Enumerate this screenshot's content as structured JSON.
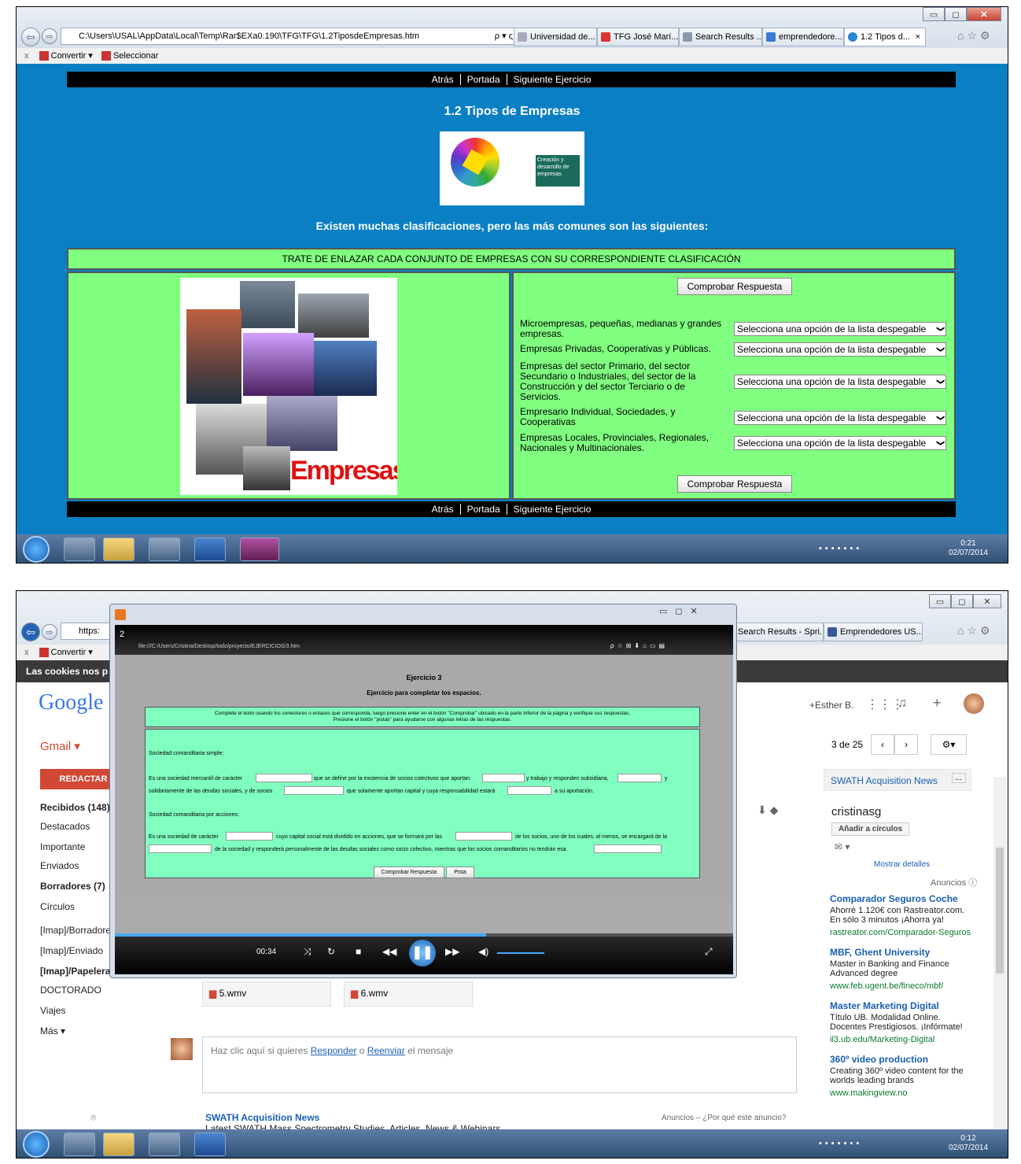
{
  "s1": {
    "address": "C:\\Users\\USAL\\AppData\\Local\\Temp\\Rar$EXa0.190\\TFG\\TFG\\1.2TiposdeEmpresas.htm",
    "search_glyphs": "ρ ▾ ς",
    "tabs": [
      "Universidad de...",
      "TFG José Marí...",
      "Search Results ...",
      "emprendedore...",
      "1.2 Tipos d..."
    ],
    "tab_close": "×",
    "cmd_close": "x",
    "cmd_convert": "Convertir",
    "cmd_select": "Seleccionar",
    "nav": {
      "back": "Atrás",
      "cover": "Portada",
      "next": "Siguiente Ejercicio"
    },
    "title": "1.2 Tipos de Empresas",
    "logo_text": "Creación y desarrollo de empresas",
    "subtitle": "Existen muchas clasificaciones, pero las más comunes son las siguientes:",
    "instruction": "TRATE DE ENLAZAR CADA CONJUNTO DE EMPRESAS CON SU CORRESPONDIENTE CLASIFICACIÓN",
    "image_caption": "Empresas",
    "check_button": "Comprobar Respuesta",
    "questions": [
      "Microempresas, pequeñas, medianas y grandes empresas.",
      "Empresas Privadas, Cooperativas y Públicas.",
      "Empresas del sector Primario, del sector Secundario o Industriales, del sector de la Construcción y del sector Terciario o de Servicios.",
      "Empresario Individual, Sociedades, y Cooperativas",
      "Empresas Locales, Provinciales, Regionales, Nacionales y Multinacionales."
    ],
    "select_placeholder": "Selecciona una opción de la lista despegable",
    "clock_time": "0:21",
    "clock_date": "02/07/2014"
  },
  "s2": {
    "gmail_address": "https:",
    "gmail_tabs": [
      "Search Results - Spri...",
      "Emprendedores US..."
    ],
    "cmd_convert": "Convertir",
    "cookies": "Las cookies nos p",
    "google": "Google",
    "gmail": "Gmail ▾",
    "user": "+Esther B.",
    "compose": "REDACTAR",
    "folders": [
      "Recibidos (148)",
      "Destacados",
      "Importante",
      "Enviados",
      "Borradores (7)",
      "Círculos",
      "[Imap]/Borradore",
      "[Imap]/Enviado",
      "[Imap]/Papelera",
      "DOCTORADO",
      "Viajes",
      "Más ▾"
    ],
    "pager": "3 de 25",
    "contact_card_title": "SWATH Acquisition News",
    "contact_card_more": "...",
    "contact_name": "cristinasg",
    "add_circles": "Añadir a círculos",
    "show_details": "Mostrar detalles",
    "ads_label": "Anuncios ⓘ",
    "ads": [
      {
        "title": "Comparador Seguros Coche",
        "body": "Ahorré 1.120€ con Rastreator.com. En sólo 3 minutos ¡Ahorra ya!",
        "url": "rastreator.com/Comparador-Seguros"
      },
      {
        "title": "MBF, Ghent University",
        "body": "Master in Banking and Finance Advanced degree",
        "url": "www.feb.ugent.be/fineco/mbf/"
      },
      {
        "title": "Master Marketing Digital",
        "body": "Título UB. Modalidad Online. Docentes Prestigiosos. ¡Infórmate!",
        "url": "il3.ub.edu/Marketing-Digital"
      },
      {
        "title": "360º video production",
        "body": "Creating 360º video content for the worlds leading brands",
        "url": "www.makingview.no"
      }
    ],
    "attachments": [
      "5.wmv",
      "6.wmv"
    ],
    "reply_text_pre": "Haz clic aquí si quieres ",
    "reply_link": "Responder",
    "reply_mid": " o ",
    "forward_link": "Reenviar",
    "reply_post": " el mensaje",
    "bottom_sender": "SWATH Acquisition News",
    "bottom_ads": "Anuncios – ¿Por qué este anuncio?",
    "bottom_snippet": "Latest SWATH Mass Spectrometry Studies, Articles, News & Webinars",
    "player_title": "2",
    "player_addr": "file:///C:/Users/Cristina/Desktop/todo/proyecto/EJERCICIOS/3.htm",
    "player_time": "00:34",
    "ex_title": "Ejercicio 3",
    "ex_subtitle": "Ejercicio para completar los espacios.",
    "ex_instruction1": "Complete el texto usando los conectores o enlaces que corresponda, luego presione enter en el botón \"Comprobar\" ubicado en la parte inferior de la página y verifique sus respuestas.",
    "ex_instruction2": "Presione el botón \"pistas\" para ayudarse con algunas letras de las respuestas.",
    "ex_h1": "Sociedad comanditaria simple:",
    "ex_l1a": "Es una sociedad mercantil de carácter",
    "ex_l1b": "que se define por la existencia de socios colectivos que aportan",
    "ex_l1c": "y trabajo y responden subsidiaria,",
    "ex_l1d": "y",
    "ex_l2a": "solidariamente de las deudas sociales, y de socios",
    "ex_l2b": "que solamente aportan capital y cuya responsabilidad estará",
    "ex_l2c": "a su aportación.",
    "ex_h2": "Sociedad comanditaria por acciones:",
    "ex_l3a": "Es una sociedad de carácter",
    "ex_l3b": "cuyo capital social está dividido en acciones, que se formará por las",
    "ex_l3c": "de los socios, uno de los cuales, al menos, se encargará de la",
    "ex_l4a": "de la sociedad y responderá personalmente de las deudas sociales como socio colectivo, mientras que los socios comanditarios no tendrán esa",
    "ex_btn_check": "Comprobar Respuesta",
    "ex_btn_hint": "Pista",
    "clock_time": "0:12",
    "clock_date": "02/07/2014"
  }
}
